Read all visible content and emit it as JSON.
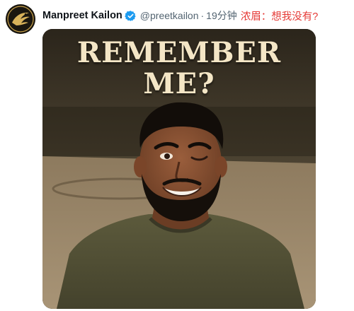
{
  "tweet": {
    "display_name": "Manpreet Kailon",
    "handle": "@preetkailon",
    "separator": "·",
    "time": "19分钟",
    "caption": "浓眉：想我没有?",
    "verified": true,
    "accent_verified_color": "#1d9bf0",
    "caption_color": "#e53935"
  },
  "media": {
    "headline_line1": "REMEMBER",
    "headline_line2": "ME?"
  },
  "icons": {
    "avatar": "golden-bird-logo-icon",
    "verified": "verified-badge-icon"
  }
}
